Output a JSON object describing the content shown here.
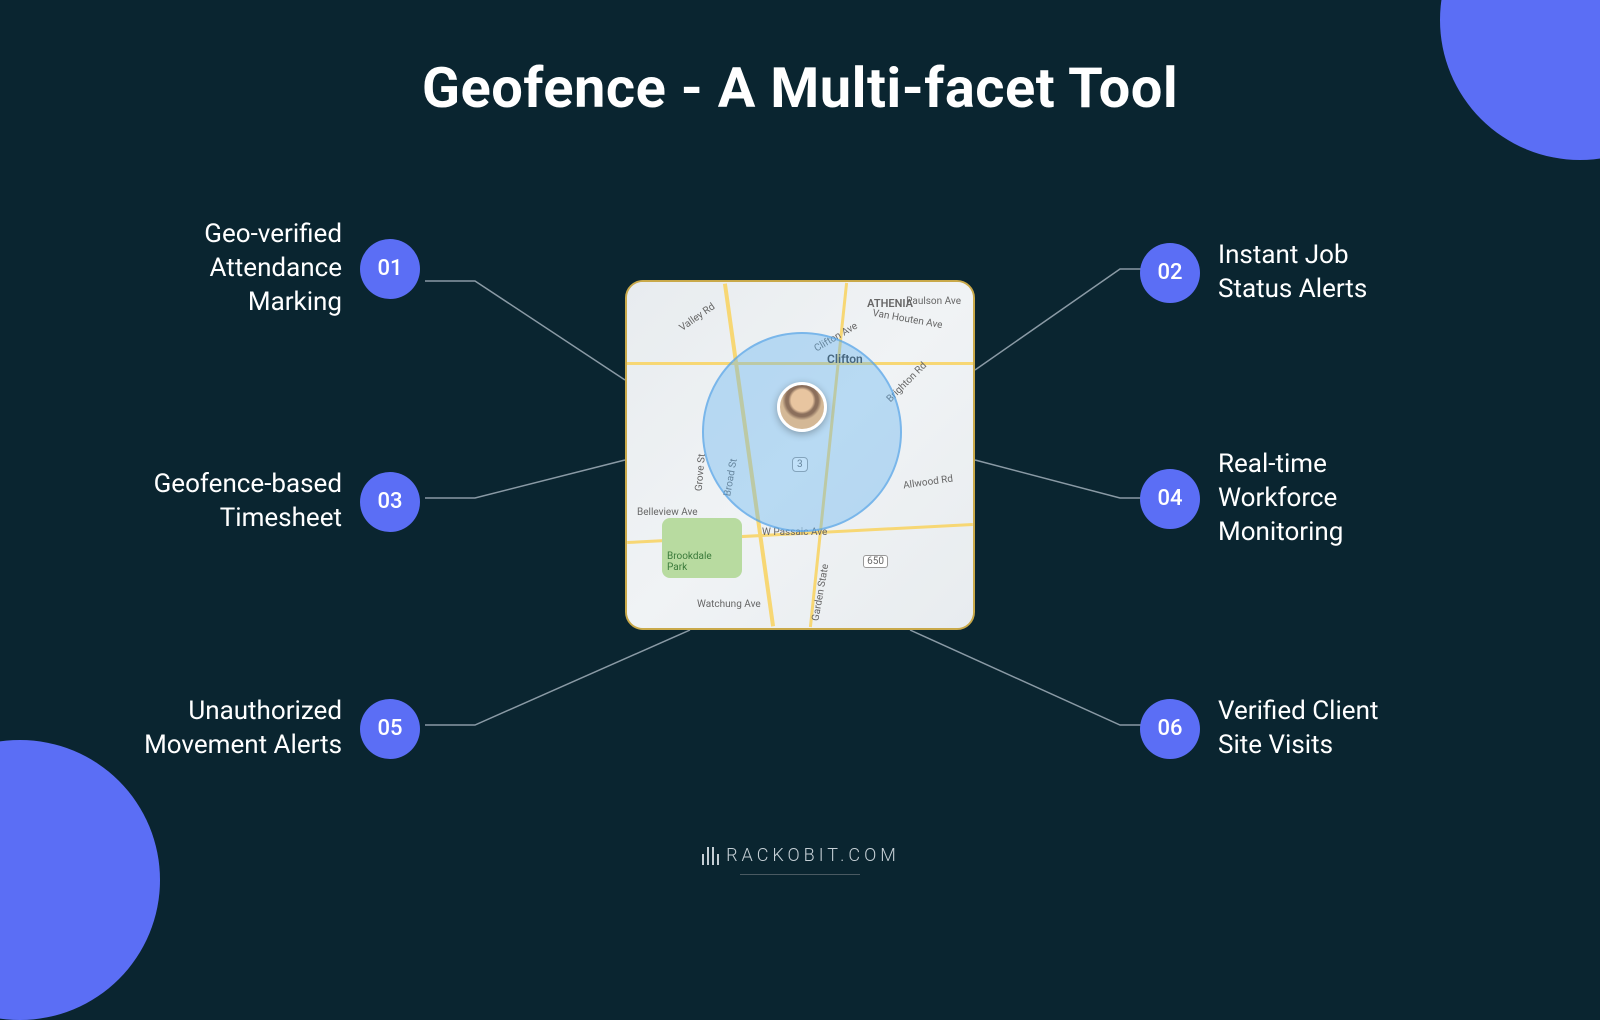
{
  "title": "Geofence - A Multi-facet Tool",
  "features": {
    "f1": {
      "num": "01",
      "label": "Geo-verified\nAttendance\nMarking"
    },
    "f2": {
      "num": "02",
      "label": "Instant Job\nStatus Alerts"
    },
    "f3": {
      "num": "03",
      "label": "Geofence-based\nTimesheet"
    },
    "f4": {
      "num": "04",
      "label": "Real-time\nWorkforce\nMonitoring"
    },
    "f5": {
      "num": "05",
      "label": "Unauthorized\nMovement Alerts"
    },
    "f6": {
      "num": "06",
      "label": "Verified Client\nSite Visits"
    }
  },
  "map_labels": {
    "athenia": "ATHENIA",
    "clifton": "Clifton",
    "brookdale": "Brookdale\nPark",
    "passaic": "W Passaic Ave",
    "allwood": "Allwood Rd",
    "valley": "Valley Rd",
    "belleview": "Belleview Ave",
    "broad": "Broad St",
    "clifton_ave": "Clifton Ave",
    "brighton": "Brighton Rd",
    "route3": "3",
    "route650": "650",
    "vanhouten": "Van Houten Ave",
    "paulson": "Paulson Ave",
    "grove": "Grove St",
    "garden": "Garden State",
    "watchung": "Watchung Ave"
  },
  "footer": "RACKOBIT.COM",
  "colors": {
    "bg": "#0a2530",
    "accent": "#5b6ef5",
    "map_border": "#c9a94a"
  }
}
